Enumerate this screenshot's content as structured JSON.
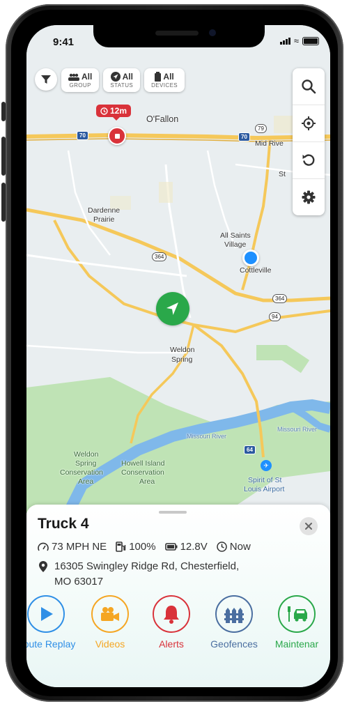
{
  "status_bar": {
    "time": "9:41"
  },
  "filters": {
    "group": {
      "value": "All",
      "label": "GROUP"
    },
    "status": {
      "value": "All",
      "label": "STATUS"
    },
    "devices": {
      "value": "All",
      "label": "DEVICES"
    }
  },
  "map": {
    "timer_badge": "12m",
    "labels": {
      "ofallon": "O'Fallon",
      "mid_rivers": "Mid Rive",
      "st": "St",
      "dardenne": "Dardenne",
      "prairie": "Prairie",
      "all_saints": "All Saints",
      "village": "Village",
      "cottleville": "Cottleville",
      "weldon": "Weldon",
      "spring": "Spring",
      "missouri_river": "Missouri River",
      "missouri_river2": "Missouri River",
      "weldon_spring_ca_1": "Weldon",
      "weldon_spring_ca_2": "Spring",
      "weldon_spring_ca_3": "Conservation",
      "weldon_spring_ca_4": "Area",
      "howell_1": "Howell Island",
      "howell_2": "Conservation",
      "howell_3": "Area",
      "airport_1": "Spirit of St",
      "airport_2": "Louis Airport"
    },
    "shields": {
      "i70_left": "70",
      "i70_right": "70",
      "r79": "79",
      "r364a": "364",
      "r364b": "364",
      "r94": "94",
      "i64": "64"
    }
  },
  "vehicle": {
    "name": "Truck 4",
    "speed": "73 MPH NE",
    "fuel": "100%",
    "voltage": "12.8V",
    "time": "Now",
    "address_line1": "16305 Swingley Ridge Rd, Chesterfield,",
    "address_line2": "MO 63017"
  },
  "actions": [
    {
      "label": "Route Replay",
      "color": "#2f8fe6",
      "icon": "play-icon"
    },
    {
      "label": "Videos",
      "color": "#f5a623",
      "icon": "video-camera-icon"
    },
    {
      "label": "Alerts",
      "color": "#d9323a",
      "icon": "bell-icon"
    },
    {
      "label": "Geofences",
      "color": "#4a6ea0",
      "icon": "fence-icon"
    },
    {
      "label": "Maintenar",
      "color": "#2aa84a",
      "icon": "car-service-icon"
    }
  ],
  "colors": {
    "map_background": "#e9eef0",
    "highway": "#f5c85a",
    "park": "#bfe3b5",
    "water": "#7fb8ea",
    "vehicle_marker": "#2aa84a",
    "stop_marker": "#d9323a",
    "user_location": "#1e90ff"
  }
}
